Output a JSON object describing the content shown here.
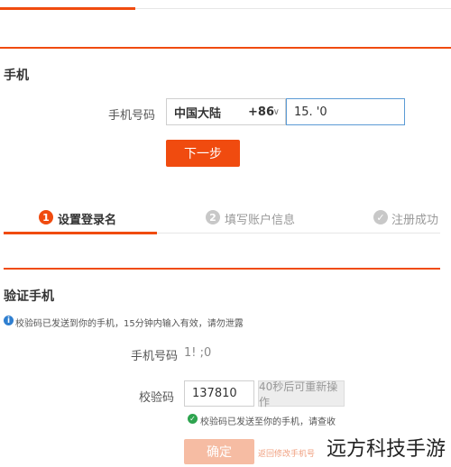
{
  "top": {
    "phone_section_title": "手机",
    "phone_label": "手机号码",
    "country": "中国大陆",
    "country_code": "+86",
    "phone_value": "15.        '0",
    "next_button": "下一步"
  },
  "steps": [
    {
      "num": "1",
      "label": "设置登录名"
    },
    {
      "num": "2",
      "label": "填写账户信息"
    },
    {
      "num": "✓",
      "label": "注册成功"
    }
  ],
  "verify": {
    "section_title": "验证手机",
    "info_text": "校验码已发送到你的手机，15分钟内输入有效，请勿泄露",
    "phone_label": "手机号码",
    "phone_value": "1!              ;0",
    "code_label": "校验码",
    "code_value": "137810",
    "resend_button": "40秒后可重新操作",
    "sent_note": "校验码已发送至你的手机，请查收",
    "confirm_button": "确定",
    "change_phone_link": "返回修改手机号"
  },
  "watermark": "远方科技手游",
  "colors": {
    "accent": "#f04b0f",
    "info": "#2f7fd0",
    "success": "#2ea44f"
  }
}
